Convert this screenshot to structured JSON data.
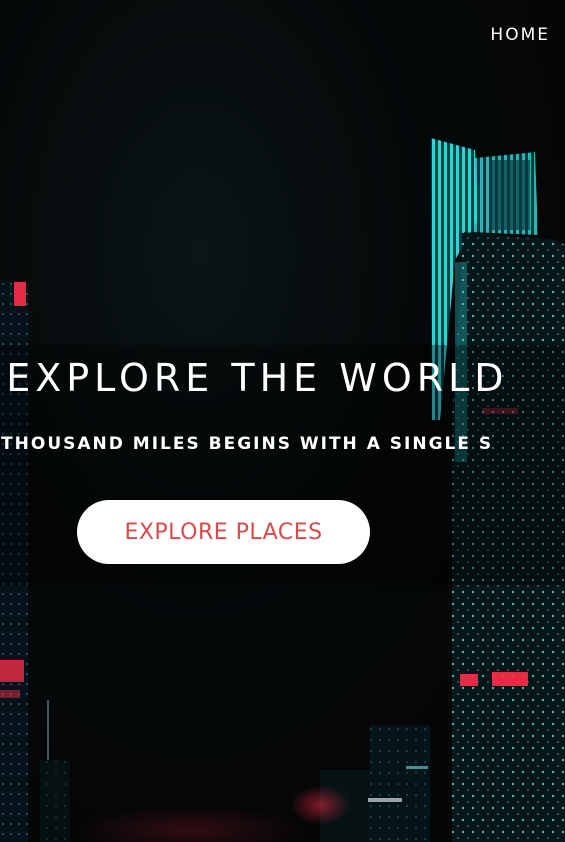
{
  "nav": {
    "home_label": "HOME"
  },
  "hero": {
    "title": "S EXPLORE THE WORLD",
    "subtitle": "OF A THOUSAND MILES BEGINS WITH A SINGLE S",
    "cta_label": "EXPLORE PLACES"
  },
  "colors": {
    "background": "#020304",
    "text": "#ffffff",
    "cta_background": "#ffffff",
    "cta_text": "#d94a4a",
    "neon_cyan": "#2fd6d6",
    "neon_red": "#ff2d4a"
  }
}
